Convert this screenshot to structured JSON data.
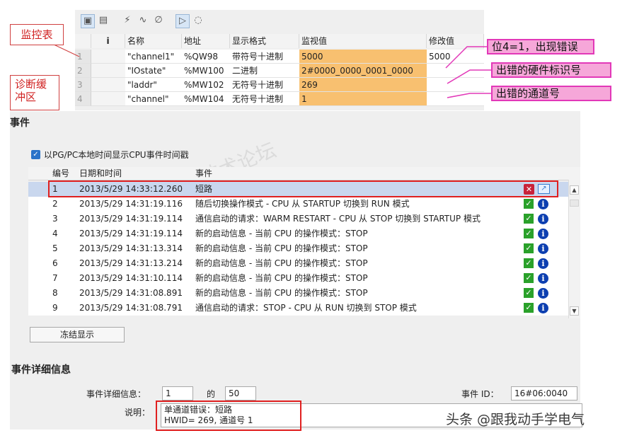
{
  "watch_table": {
    "headers": {
      "info": "i",
      "name": "名称",
      "address": "地址",
      "format": "显示格式",
      "monitor": "监视值",
      "modify": "修改值"
    },
    "rows": [
      {
        "idx": "1",
        "name": "\"channel1\"",
        "address": "%QW98",
        "format": "带符号十进制",
        "monitor": "5000",
        "modify": "5000"
      },
      {
        "idx": "2",
        "name": "\"IOstate\"",
        "address": "%MW100",
        "format": "二进制",
        "monitor": "2#0000_0000_0001_0000",
        "modify": ""
      },
      {
        "idx": "3",
        "name": "\"laddr\"",
        "address": "%MW102",
        "format": "无符号十进制",
        "monitor": "269",
        "modify": ""
      },
      {
        "idx": "4",
        "name": "\"channel\"",
        "address": "%MW104",
        "format": "无符号十进制",
        "monitor": "1",
        "modify": ""
      }
    ]
  },
  "callouts": {
    "watch": "监控表",
    "buffer_l1": "诊断缓",
    "buffer_l2": "冲区",
    "bit4": "位4=1，出现错误",
    "hw_id": "出错的硬件标识号",
    "channel": "出错的通道号"
  },
  "events": {
    "title": "事件",
    "checkbox_label": "以PG/PC本地时间显示CPU事件时间戳",
    "headers": {
      "no": "编号",
      "datetime": "日期和时间",
      "event": "事件"
    },
    "rows": [
      {
        "no": "1",
        "datetime": "2013/5/29 14:33:12.260",
        "event": "短路",
        "status": "error"
      },
      {
        "no": "2",
        "datetime": "2013/5/29 14:31:19.116",
        "event": "随后切换操作模式 - CPU 从 STARTUP 切换到 RUN 模式",
        "status": "ok"
      },
      {
        "no": "3",
        "datetime": "2013/5/29 14:31:19.114",
        "event": "通信启动的请求：WARM RESTART - CPU 从 STOP 切换到 STARTUP 模式",
        "status": "ok"
      },
      {
        "no": "4",
        "datetime": "2013/5/29 14:31:19.114",
        "event": "新的启动信息 - 当前 CPU 的操作模式：STOP",
        "status": "ok"
      },
      {
        "no": "5",
        "datetime": "2013/5/29 14:31:13.314",
        "event": "新的启动信息 - 当前 CPU 的操作模式：STOP",
        "status": "ok"
      },
      {
        "no": "6",
        "datetime": "2013/5/29 14:31:13.214",
        "event": "新的启动信息 - 当前 CPU 的操作模式：STOP",
        "status": "ok"
      },
      {
        "no": "7",
        "datetime": "2013/5/29 14:31:10.114",
        "event": "新的启动信息 - 当前 CPU 的操作模式：STOP",
        "status": "ok"
      },
      {
        "no": "8",
        "datetime": "2013/5/29 14:31:08.891",
        "event": "新的启动信息 - 当前 CPU 的操作模式：STOP",
        "status": "ok"
      },
      {
        "no": "9",
        "datetime": "2013/5/29 14:31:08.791",
        "event": "通信启动的请求：STOP - CPU 从 RUN 切换到 STOP 模式",
        "status": "ok"
      }
    ],
    "freeze_button": "冻结显示"
  },
  "details": {
    "title": "事件详细信息",
    "info_label": "事件详细信息：",
    "index": "1",
    "of_label": "的",
    "total": "50",
    "id_label": "事件 ID：",
    "id_value": "16#06:0040",
    "desc_label": "说明：",
    "desc_line1": "单通道错误：短路",
    "desc_line2": "HWID=  269,  通道号    1"
  },
  "overlay": {
    "watermark": "技术论坛",
    "credit": "头条 @跟我动手学电气"
  },
  "colors": {
    "monitor_bg": "#f8c070",
    "callout_pink": "#f6a7d9",
    "callout_border": "#e238b8",
    "highlight_red": "#e02020",
    "selected_row": "#c9d7ee"
  }
}
